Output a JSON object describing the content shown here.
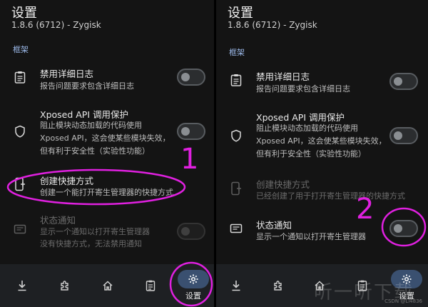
{
  "screens": [
    {
      "header": {
        "title": "设置",
        "subtitle": "1.8.6 (6712) - Zygisk"
      },
      "section": "框架",
      "items": [
        {
          "title": "禁用详细日志",
          "desc": [
            "报告问题要求包含详细日志"
          ]
        },
        {
          "title": "Xposed API 调用保护",
          "desc": [
            "阻止模块动态加载的代码使用",
            "Xposed API，这会使某些模块失效，",
            "但有利于安全性（实验性功能）"
          ]
        },
        {
          "title": "创建快捷方式",
          "desc": [
            "创建一个能打开寄生管理器的快捷方式"
          ]
        },
        {
          "title": "状态通知",
          "desc": [
            "显示一个通知以打开寄生管理器",
            "没有快捷方式，无法禁用通知"
          ]
        }
      ],
      "nav": {
        "active_label": "设置"
      },
      "annotation": "1"
    },
    {
      "header": {
        "title": "设置",
        "subtitle": "1.8.6 (6712) - Zygisk"
      },
      "section": "框架",
      "items": [
        {
          "title": "禁用详细日志",
          "desc": [
            "报告问题要求包含详细日志"
          ]
        },
        {
          "title": "Xposed API 调用保护",
          "desc": [
            "阻止模块动态加载的代码使用",
            "Xposed API，这会使某些模块失效，",
            "但有利于安全性（实验性功能）"
          ]
        },
        {
          "title": "创建快捷方式",
          "desc": [
            "已经创建了用于打开寄生管理器的快捷方式"
          ]
        },
        {
          "title": "状态通知",
          "desc": [
            "显示一个通知以打开寄生管理器"
          ]
        }
      ],
      "nav": {
        "active_label": "设置"
      },
      "annotation": "2"
    }
  ],
  "watermark": "CSDN @Li4836",
  "overlay_logo_text": "听一听下载",
  "colors": {
    "annotation": "#e020e0",
    "section": "#9bb8e8",
    "nav_active": "#3a5070"
  },
  "icons": [
    "clipboard-icon",
    "shield-icon",
    "shortcut-icon",
    "notification-icon",
    "download-icon",
    "puzzle-icon",
    "home-icon",
    "log-icon",
    "settings-icon"
  ]
}
